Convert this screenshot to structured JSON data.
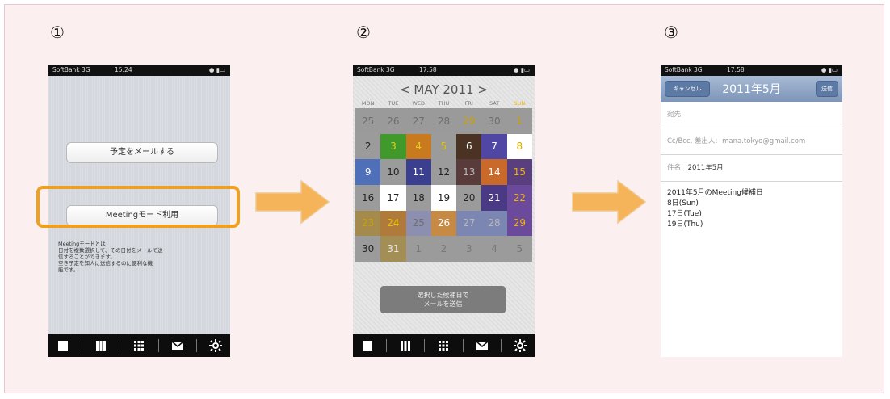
{
  "steps": [
    "①",
    "②",
    "③"
  ],
  "status_bar": {
    "p1": {
      "carrier": "SoftBank 3G",
      "time": "15:24"
    },
    "p2": {
      "carrier": "SoftBank 3G",
      "time": "17:58"
    },
    "p3": {
      "carrier": "SoftBank 3G",
      "time": "17:58"
    }
  },
  "phone1": {
    "mail_button": "予定をメールする",
    "meeting_button": "Meetingモード利用",
    "description": [
      "Meetingモードとは",
      "日付を複数選択して、その日付をメールで送",
      "信することができます。",
      "空き予定を知人に送信するのに便利な機",
      "能です。"
    ]
  },
  "phone2": {
    "month_title": "< MAY 2011 >",
    "weekdays": [
      "MON",
      "TUE",
      "WED",
      "THU",
      "FRI",
      "SAT",
      "SUN"
    ],
    "colors": {
      "sunday": "#f0b400",
      "highlight": "#ffffff"
    },
    "days": [
      {
        "d": "25",
        "bg": "#9a9a9a",
        "fg": "#6e6e6e"
      },
      {
        "d": "26",
        "bg": "#9a9a9a",
        "fg": "#6e6e6e"
      },
      {
        "d": "27",
        "bg": "#9a9a9a",
        "fg": "#6e6e6e"
      },
      {
        "d": "28",
        "bg": "#9a9a9a",
        "fg": "#6e6e6e"
      },
      {
        "d": "29",
        "bg": "#9a9a9a",
        "fg": "#c9a200"
      },
      {
        "d": "30",
        "bg": "#9a9a9a",
        "fg": "#6e6e6e"
      },
      {
        "d": "1",
        "bg": "#9a9a9a",
        "fg": "#c9a200"
      },
      {
        "d": "2",
        "bg": "#9b9b9b",
        "fg": "#222"
      },
      {
        "d": "3",
        "bg": "#3f9a2b",
        "fg": "#e0d020"
      },
      {
        "d": "4",
        "bg": "#c97a1e",
        "fg": "#e0d020"
      },
      {
        "d": "5",
        "bg": "#9b9b9b",
        "fg": "#e0c000"
      },
      {
        "d": "6",
        "bg": "#4a3322",
        "fg": "#ffffff"
      },
      {
        "d": "7",
        "bg": "#4f47a3",
        "fg": "#ffffff"
      },
      {
        "d": "8",
        "bg": "#ffffff",
        "fg": "#e0a800"
      },
      {
        "d": "9",
        "bg": "#4f6fb8",
        "fg": "#ffffff"
      },
      {
        "d": "10",
        "bg": "#9b9b9b",
        "fg": "#222"
      },
      {
        "d": "11",
        "bg": "#3b3f8f",
        "fg": "#ffffff"
      },
      {
        "d": "12",
        "bg": "#9b9b9b",
        "fg": "#222"
      },
      {
        "d": "13",
        "bg": "#5a3b3b",
        "fg": "#b8b8b8"
      },
      {
        "d": "14",
        "bg": "#c9692a",
        "fg": "#ffffff"
      },
      {
        "d": "15",
        "bg": "#5a3f7e",
        "fg": "#f0b400"
      },
      {
        "d": "16",
        "bg": "#9b9b9b",
        "fg": "#222"
      },
      {
        "d": "17",
        "bg": "#ffffff",
        "fg": "#222"
      },
      {
        "d": "18",
        "bg": "#9b9b9b",
        "fg": "#222"
      },
      {
        "d": "19",
        "bg": "#ffffff",
        "fg": "#222"
      },
      {
        "d": "20",
        "bg": "#9b9b9b",
        "fg": "#222"
      },
      {
        "d": "21",
        "bg": "#4a3a85",
        "fg": "#ffffff"
      },
      {
        "d": "22",
        "bg": "#6b4a9b",
        "fg": "#f0b400"
      },
      {
        "d": "23",
        "bg": "#a58a4d",
        "fg": "#c9a200"
      },
      {
        "d": "24",
        "bg": "#b07a3a",
        "fg": "#e8c000"
      },
      {
        "d": "25",
        "bg": "#8c8fb0",
        "fg": "#6e6e6e"
      },
      {
        "d": "26",
        "bg": "#c78a45",
        "fg": "#ffffff"
      },
      {
        "d": "27",
        "bg": "#7b86b3",
        "fg": "#b8b8b8"
      },
      {
        "d": "28",
        "bg": "#7b86b3",
        "fg": "#b8b8b8"
      },
      {
        "d": "29",
        "bg": "#6b4a9b",
        "fg": "#f0b400"
      },
      {
        "d": "30",
        "bg": "#9b9b9b",
        "fg": "#222"
      },
      {
        "d": "31",
        "bg": "#a38f55",
        "fg": "#e8e8e8"
      },
      {
        "d": "1",
        "bg": "#9b9b9b",
        "fg": "#777"
      },
      {
        "d": "2",
        "bg": "#9b9b9b",
        "fg": "#777"
      },
      {
        "d": "3",
        "bg": "#9b9b9b",
        "fg": "#777"
      },
      {
        "d": "4",
        "bg": "#9b9b9b",
        "fg": "#777"
      },
      {
        "d": "5",
        "bg": "#9b9b9b",
        "fg": "#777"
      }
    ],
    "send_button": [
      "選択した候補日で",
      "メールを送信"
    ]
  },
  "phone3": {
    "cancel": "キャンセル",
    "title": "2011年5月",
    "send": "送信",
    "to_label": "宛先:",
    "cc_label": "Cc/Bcc, 差出人:",
    "cc_value": "mana.tokyo@gmail.com",
    "subject_label": "件名:",
    "subject_value": "2011年5月",
    "body": [
      "2011年5月のMeeting候補日",
      "8日(Sun)",
      "17日(Tue)",
      "19日(Thu)"
    ]
  },
  "arrow_color": "#f5b45a",
  "tabs": [
    "day-view-icon",
    "week-view-icon",
    "month-view-icon",
    "mail-icon",
    "settings-icon"
  ]
}
